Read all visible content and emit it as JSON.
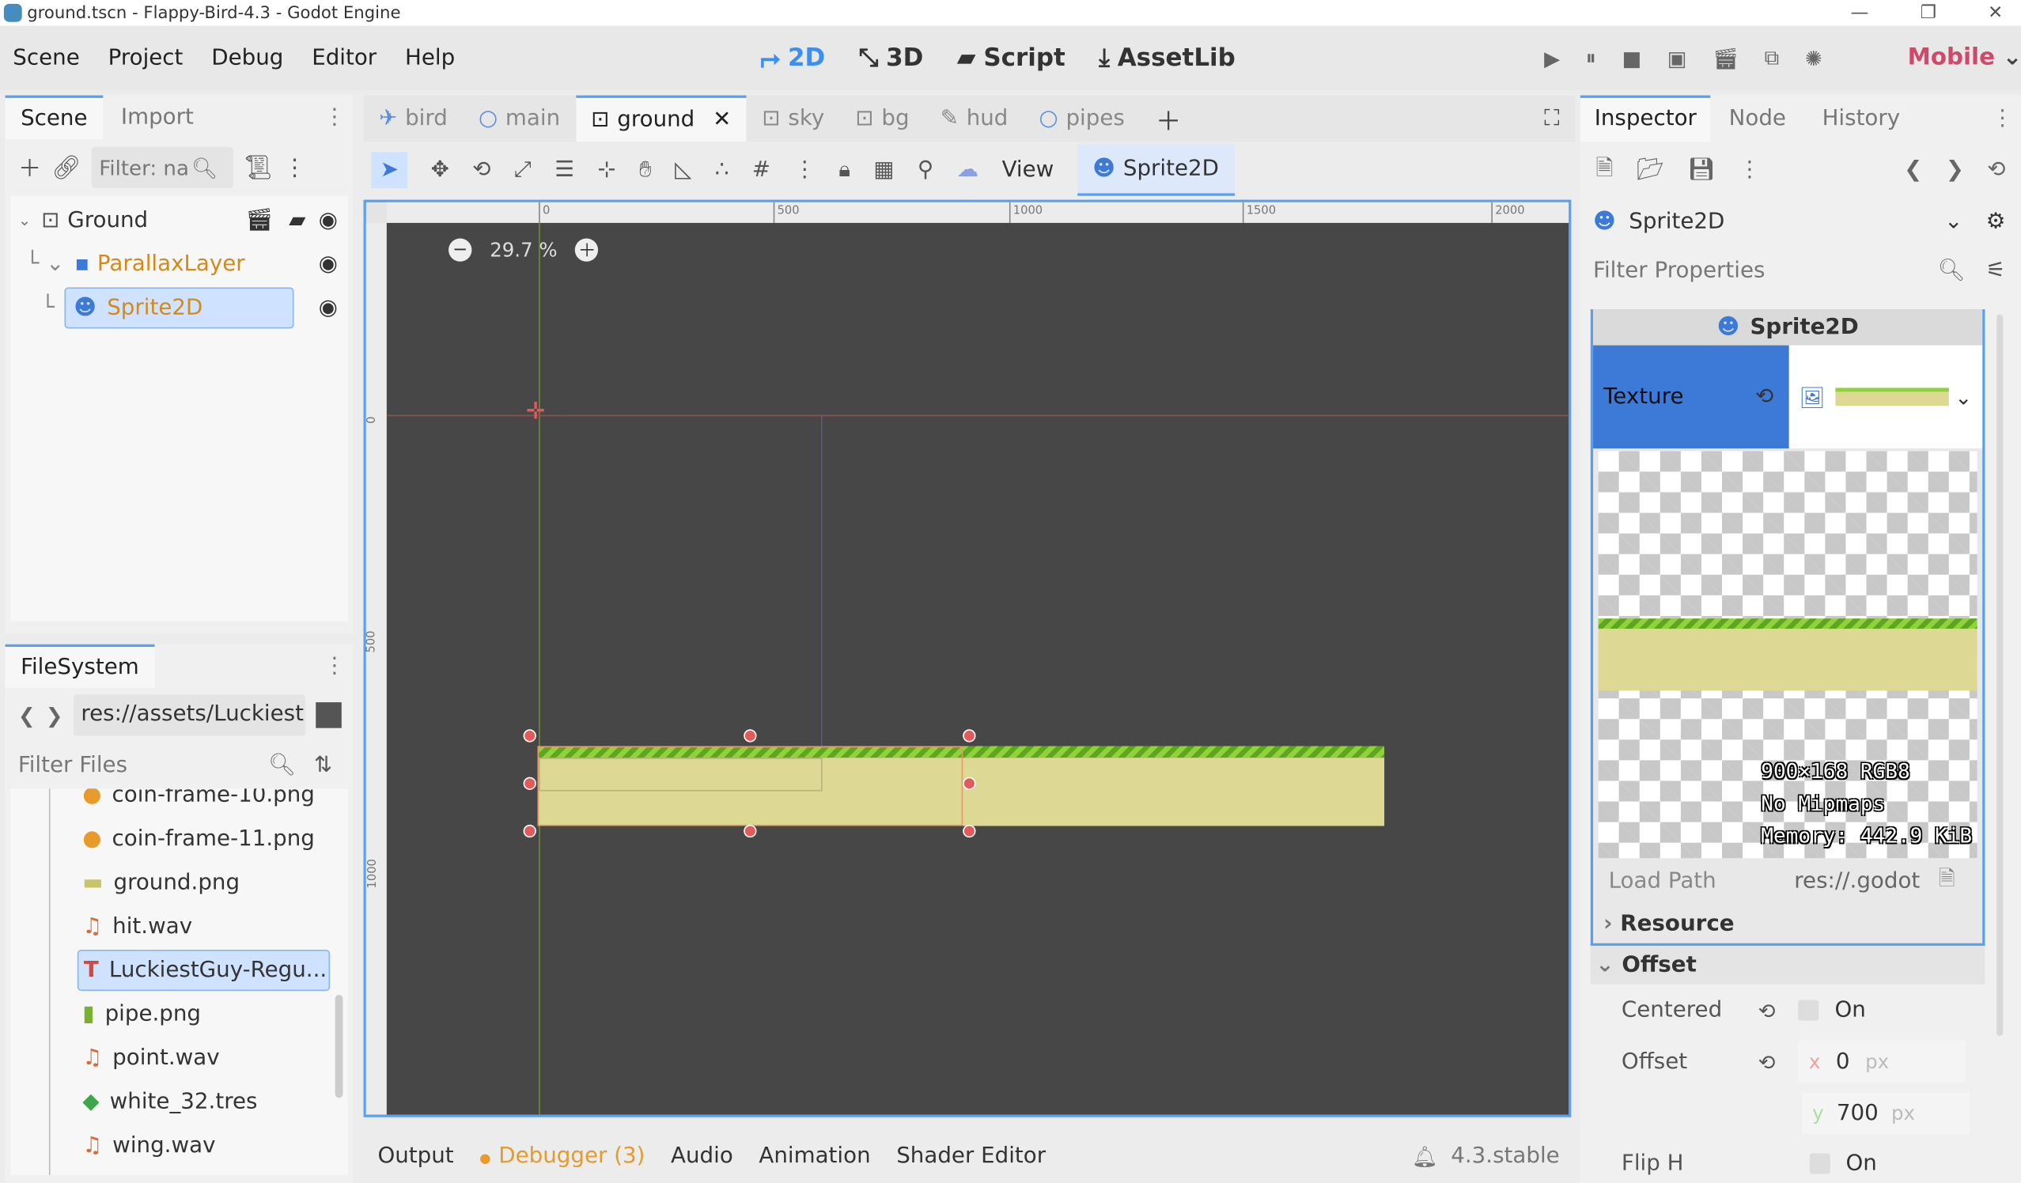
{
  "window": {
    "title": "ground.tscn - Flappy-Bird-4.3 - Godot Engine"
  },
  "menu": [
    "Scene",
    "Project",
    "Debug",
    "Editor",
    "Help"
  ],
  "workspaces": {
    "w2d": "2D",
    "w3d": "3D",
    "script": "Script",
    "assetlib": "AssetLib"
  },
  "renderer": "Mobile",
  "scene_dock": {
    "tab_scene": "Scene",
    "tab_import": "Import",
    "filter_placeholder": "Filter: na",
    "nodes": [
      {
        "label": "Ground"
      },
      {
        "label": "ParallaxLayer"
      },
      {
        "label": "Sprite2D"
      }
    ]
  },
  "filesystem": {
    "title": "FileSystem",
    "path": "res://assets/Luckiest",
    "filter_placeholder": "Filter Files",
    "files": [
      "coin-frame-10.png",
      "coin-frame-11.png",
      "ground.png",
      "hit.wav",
      "LuckiestGuy-Regu...",
      "pipe.png",
      "point.wav",
      "white_32.tres",
      "wing.wav"
    ]
  },
  "scene_tabs": [
    "bird",
    "main",
    "ground",
    "sky",
    "bg",
    "hud",
    "pipes"
  ],
  "toolbar": {
    "view": "View",
    "node_badge": "Sprite2D"
  },
  "viewport": {
    "zoom": "29.7 %",
    "ruler_h": [
      "0",
      "500",
      "1000",
      "1500",
      "2000"
    ],
    "ruler_v": [
      "0",
      "500",
      "1000"
    ]
  },
  "bottom_panel": {
    "tabs": [
      "Output",
      "Debugger (3)",
      "Audio",
      "Animation",
      "Shader Editor"
    ],
    "version": "4.3.stable"
  },
  "inspector": {
    "tabs": [
      "Inspector",
      "Node",
      "History"
    ],
    "node_type": "Sprite2D",
    "filter_placeholder": "Filter Properties",
    "section_title": "Sprite2D",
    "texture_label": "Texture",
    "texture_info": [
      "900×168 RGB8",
      "No Mipmaps",
      "Memory: 442.9 KiB"
    ],
    "load_path_label": "Load Path",
    "load_path_value": "res://.godot",
    "resource_label": "Resource",
    "offset_section": "Offset",
    "centered_label": "Centered",
    "centered_value": "On",
    "offset_label": "Offset",
    "offset_x_axis": "x",
    "offset_x": "0",
    "offset_y_axis": "y",
    "offset_y": "700",
    "unit": "px",
    "fliph_label": "Flip H",
    "fliph_value": "On"
  }
}
